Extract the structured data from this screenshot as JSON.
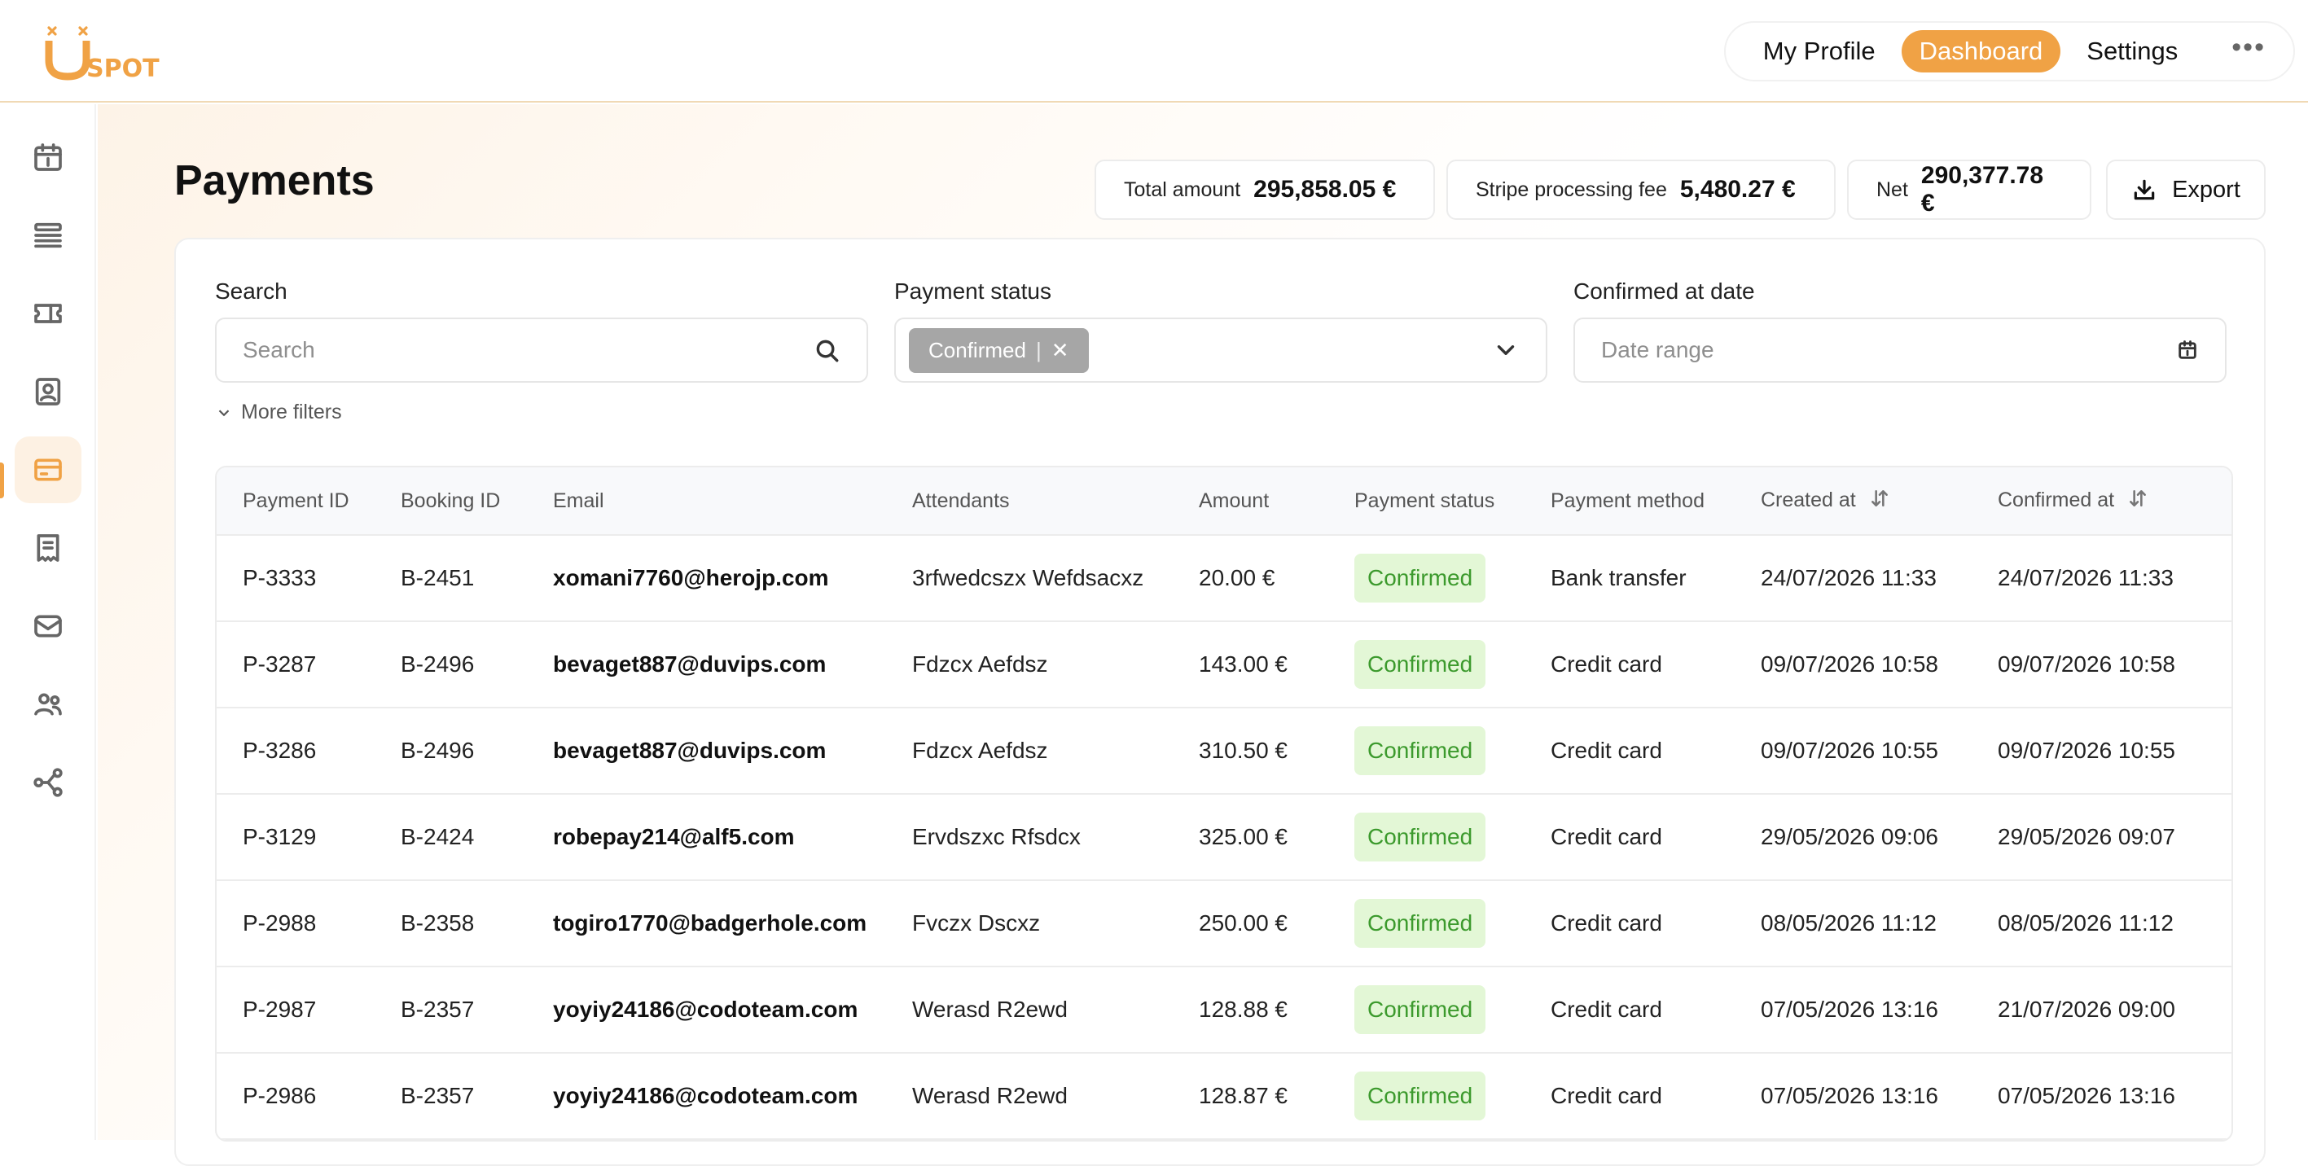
{
  "app": {
    "logo_text": "USPOT",
    "brand_color": "#f0a245"
  },
  "topnav": {
    "items": [
      {
        "label": "My Profile",
        "active": false
      },
      {
        "label": "Dashboard",
        "active": true
      },
      {
        "label": "Settings",
        "active": false
      }
    ],
    "more_label": "•••"
  },
  "sidebar": {
    "items": [
      {
        "icon": "calendar-icon",
        "active": false
      },
      {
        "icon": "list-icon",
        "active": false
      },
      {
        "icon": "ticket-icon",
        "active": false
      },
      {
        "icon": "contact-card-icon",
        "active": false
      },
      {
        "icon": "credit-card-icon",
        "active": true
      },
      {
        "icon": "receipt-icon",
        "active": false
      },
      {
        "icon": "mail-icon",
        "active": false
      },
      {
        "icon": "users-icon",
        "active": false
      },
      {
        "icon": "share-network-icon",
        "active": false
      }
    ]
  },
  "page": {
    "title": "Payments"
  },
  "stats": {
    "total_label": "Total amount",
    "total_value": "295,858.05 €",
    "fee_label": "Stripe processing fee",
    "fee_value": "5,480.27 €",
    "net_label": "Net",
    "net_value": "290,377.78 €",
    "export_label": "Export"
  },
  "filters": {
    "search_label": "Search",
    "search_placeholder": "Search",
    "status_label": "Payment status",
    "status_chip": "Confirmed",
    "date_label": "Confirmed at date",
    "date_placeholder": "Date range",
    "more_filters": "More filters"
  },
  "table": {
    "columns": [
      "Payment ID",
      "Booking ID",
      "Email",
      "Attendants",
      "Amount",
      "Payment status",
      "Payment method",
      "Created at",
      "Confirmed at"
    ],
    "rows": [
      [
        "P-3333",
        "B-2451",
        "xomani7760@herojp.com",
        "3rfwedcszx Wefdsacxz",
        "20.00 €",
        "Confirmed",
        "Bank transfer",
        "24/07/2026 11:33",
        "24/07/2026 11:33"
      ],
      [
        "P-3287",
        "B-2496",
        "bevaget887@duvips.com",
        "Fdzcx Aefdsz",
        "143.00 €",
        "Confirmed",
        "Credit card",
        "09/07/2026 10:58",
        "09/07/2026 10:58"
      ],
      [
        "P-3286",
        "B-2496",
        "bevaget887@duvips.com",
        "Fdzcx Aefdsz",
        "310.50 €",
        "Confirmed",
        "Credit card",
        "09/07/2026 10:55",
        "09/07/2026 10:55"
      ],
      [
        "P-3129",
        "B-2424",
        "robepay214@alf5.com",
        "Ervdszxc Rfsdcx",
        "325.00 €",
        "Confirmed",
        "Credit card",
        "29/05/2026 09:06",
        "29/05/2026 09:07"
      ],
      [
        "P-2988",
        "B-2358",
        "togiro1770@badgerhole.com",
        "Fvczx Dscxz",
        "250.00 €",
        "Confirmed",
        "Credit card",
        "08/05/2026 11:12",
        "08/05/2026 11:12"
      ],
      [
        "P-2987",
        "B-2357",
        "yoyiy24186@codoteam.com",
        "Werasd R2ewd",
        "128.88 €",
        "Confirmed",
        "Credit card",
        "07/05/2026 13:16",
        "21/07/2026 09:00"
      ],
      [
        "P-2986",
        "B-2357",
        "yoyiy24186@codoteam.com",
        "Werasd R2ewd",
        "128.87 €",
        "Confirmed",
        "Credit card",
        "07/05/2026 13:16",
        "07/05/2026 13:16"
      ]
    ]
  }
}
